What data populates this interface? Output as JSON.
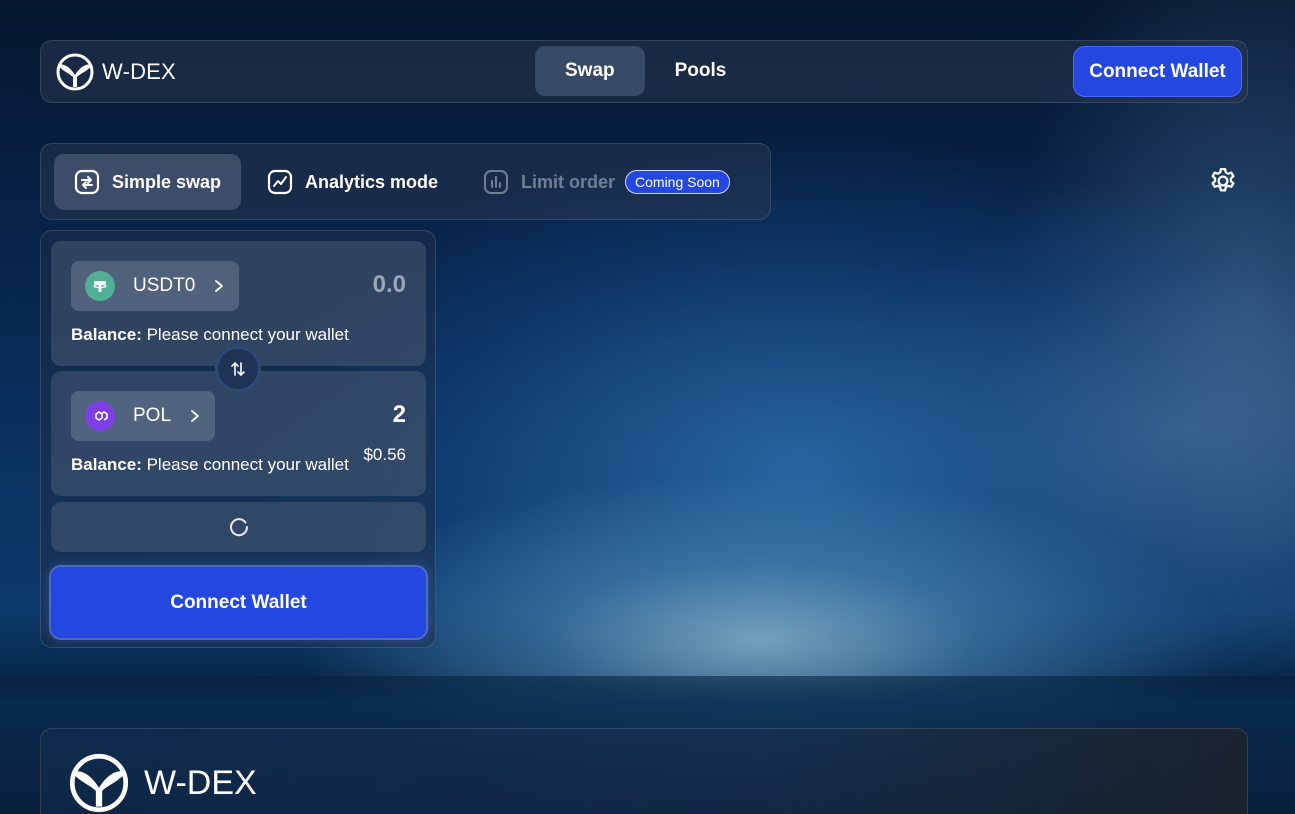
{
  "brand": {
    "name": "W-DEX",
    "logo_icon": "whale-tail-icon"
  },
  "nav": {
    "items": [
      {
        "label": "Swap",
        "active": true
      },
      {
        "label": "Pools",
        "active": false
      }
    ]
  },
  "header": {
    "connect_label": "Connect Wallet"
  },
  "modes": {
    "items": [
      {
        "label": "Simple swap",
        "icon": "swap-arrows-icon",
        "active": true
      },
      {
        "label": "Analytics mode",
        "icon": "chart-line-icon",
        "active": false
      },
      {
        "label": "Limit order",
        "icon": "bar-chart-icon",
        "disabled": true,
        "badge": "Coming Soon"
      }
    ],
    "settings_icon": "gear-icon"
  },
  "swap": {
    "from": {
      "token": "USDT0",
      "amount": "0.0",
      "balance_label": "Balance:",
      "balance_text": " Please connect your wallet"
    },
    "to": {
      "token": "POL",
      "amount": "2",
      "usd": "$0.56",
      "balance_label": "Balance:",
      "balance_text": " Please connect your wallet"
    },
    "connect_label": "Connect Wallet"
  },
  "footer": {
    "name": "W-DEX"
  },
  "colors": {
    "accent": "#2447e0",
    "usdt": "#50af95",
    "pol": "#7b3fe4"
  }
}
